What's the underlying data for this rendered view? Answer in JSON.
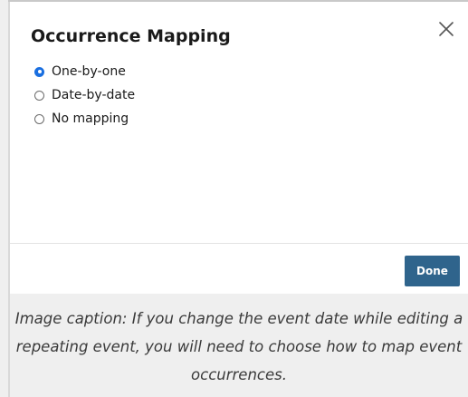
{
  "dialog": {
    "title": "Occurrence Mapping",
    "close_icon": "close-icon",
    "options": [
      {
        "label": "One-by-one",
        "checked": true
      },
      {
        "label": "Date-by-date",
        "checked": false
      },
      {
        "label": "No mapping",
        "checked": false
      }
    ],
    "done_label": "Done"
  },
  "caption": {
    "text": "Image caption: If you change the event date while editing a repeating event, you will need to choose how to map event occurrences."
  },
  "colors": {
    "primary_button": "#2f648c",
    "radio_selected": "#1a6fe0",
    "caption_background": "#efefef"
  }
}
